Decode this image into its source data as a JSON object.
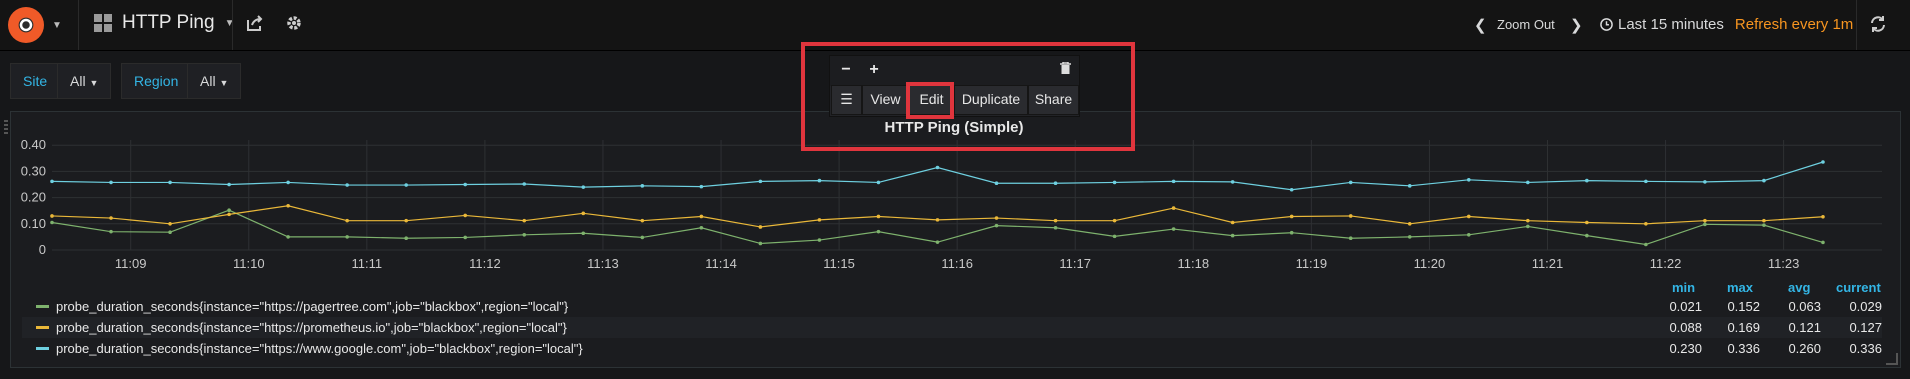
{
  "navbar": {
    "title": "HTTP Ping",
    "zoom_out": "Zoom Out",
    "time_range": "Last 15 minutes",
    "refresh": "Refresh every 1m",
    "icons": [
      "grafana-logo-icon",
      "dashboard-grid-icon",
      "share-icon",
      "gear-icon",
      "chevron-left-icon",
      "chevron-right-icon",
      "clock-icon",
      "refresh-icon"
    ]
  },
  "variables": [
    {
      "label": "Site",
      "value": "All"
    },
    {
      "label": "Region",
      "value": "All"
    }
  ],
  "panel_menu": {
    "minus": "−",
    "plus": "+",
    "view": "View",
    "edit": "Edit",
    "duplicate": "Duplicate",
    "share": "Share"
  },
  "panel": {
    "title": "HTTP Ping (Simple)"
  },
  "legend": {
    "headers": [
      "min",
      "max",
      "avg",
      "current"
    ],
    "rows": [
      {
        "name": "probe_duration_seconds{instance=\"https://pagertree.com\",job=\"blackbox\",region=\"local\"}",
        "color": "#7eb26d",
        "min": "0.021",
        "max": "0.152",
        "avg": "0.063",
        "current": "0.029"
      },
      {
        "name": "probe_duration_seconds{instance=\"https://prometheus.io\",job=\"blackbox\",region=\"local\"}",
        "color": "#eab839",
        "min": "0.088",
        "max": "0.169",
        "avg": "0.121",
        "current": "0.127"
      },
      {
        "name": "probe_duration_seconds{instance=\"https://www.google.com\",job=\"blackbox\",region=\"local\"}",
        "color": "#6ed0e0",
        "min": "0.230",
        "max": "0.336",
        "avg": "0.260",
        "current": "0.336"
      }
    ]
  },
  "chart_data": {
    "type": "line",
    "x": [
      "11:08:20",
      "11:08:50",
      "11:09:20",
      "11:09:50",
      "11:10:20",
      "11:10:50",
      "11:11:20",
      "11:11:50",
      "11:12:20",
      "11:12:50",
      "11:13:20",
      "11:13:50",
      "11:14:20",
      "11:14:50",
      "11:15:20",
      "11:15:50",
      "11:16:20",
      "11:16:50",
      "11:17:20",
      "11:17:50",
      "11:18:20",
      "11:18:50",
      "11:19:20",
      "11:19:50",
      "11:20:20",
      "11:20:50",
      "11:21:20",
      "11:21:50",
      "11:22:20",
      "11:22:50",
      "11:23:20"
    ],
    "x_tick_labels": [
      "11:09",
      "11:10",
      "11:11",
      "11:12",
      "11:13",
      "11:14",
      "11:15",
      "11:16",
      "11:17",
      "11:18",
      "11:19",
      "11:20",
      "11:21",
      "11:22",
      "11:23"
    ],
    "y_tick_labels": [
      "0",
      "0.10",
      "0.20",
      "0.30",
      "0.40"
    ],
    "ylim": [
      0,
      0.42
    ],
    "grid": true,
    "series": [
      {
        "name": "probe_duration_seconds{instance=\"https://pagertree.com\",job=\"blackbox\",region=\"local\"}",
        "color": "#7eb26d",
        "values": [
          0.105,
          0.07,
          0.068,
          0.152,
          0.05,
          0.05,
          0.045,
          0.048,
          0.058,
          0.064,
          0.048,
          0.085,
          0.025,
          0.038,
          0.07,
          0.03,
          0.093,
          0.085,
          0.052,
          0.08,
          0.055,
          0.066,
          0.045,
          0.05,
          0.058,
          0.09,
          0.055,
          0.021,
          0.098,
          0.095,
          0.029
        ]
      },
      {
        "name": "probe_duration_seconds{instance=\"https://prometheus.io\",job=\"blackbox\",region=\"local\"}",
        "color": "#eab839",
        "values": [
          0.13,
          0.122,
          0.1,
          0.136,
          0.169,
          0.112,
          0.112,
          0.132,
          0.112,
          0.14,
          0.112,
          0.128,
          0.088,
          0.115,
          0.128,
          0.115,
          0.122,
          0.112,
          0.112,
          0.16,
          0.105,
          0.128,
          0.13,
          0.1,
          0.128,
          0.112,
          0.105,
          0.1,
          0.112,
          0.112,
          0.127
        ]
      },
      {
        "name": "probe_duration_seconds{instance=\"https://www.google.com\",job=\"blackbox\",region=\"local\"}",
        "color": "#6ed0e0",
        "values": [
          0.262,
          0.258,
          0.258,
          0.25,
          0.258,
          0.248,
          0.248,
          0.25,
          0.252,
          0.24,
          0.245,
          0.242,
          0.262,
          0.265,
          0.258,
          0.315,
          0.255,
          0.255,
          0.258,
          0.262,
          0.26,
          0.23,
          0.258,
          0.245,
          0.268,
          0.258,
          0.265,
          0.262,
          0.26,
          0.265,
          0.336
        ]
      }
    ]
  }
}
